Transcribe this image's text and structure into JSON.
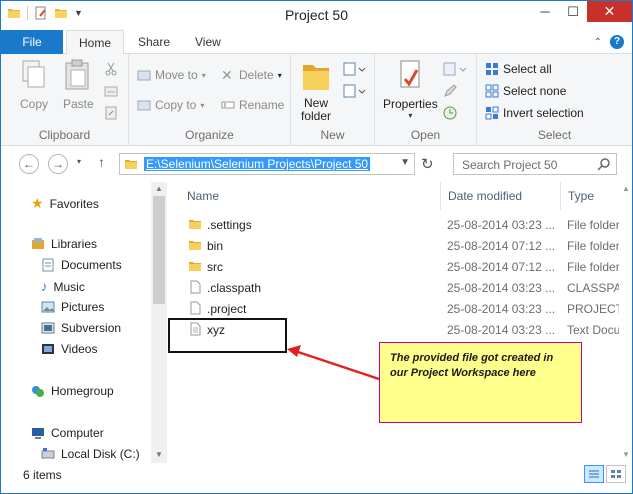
{
  "window": {
    "title": "Project 50"
  },
  "ribbon_tabs": [
    "File",
    "Home",
    "Share",
    "View"
  ],
  "ribbon": {
    "clipboard": {
      "copy": "Copy",
      "paste": "Paste",
      "group": "Clipboard"
    },
    "organize": {
      "move_to": "Move to",
      "copy_to": "Copy to",
      "delete": "Delete",
      "rename": "Rename",
      "group": "Organize"
    },
    "new": {
      "new_folder_l1": "New",
      "new_folder_l2": "folder",
      "group": "New"
    },
    "open": {
      "properties": "Properties",
      "group": "Open"
    },
    "select": {
      "select_all": "Select all",
      "select_none": "Select none",
      "invert": "Invert selection",
      "group": "Select"
    }
  },
  "address": {
    "path": "E:\\Selenium\\Selenium Projects\\Project 50"
  },
  "search": {
    "placeholder": "Search Project 50"
  },
  "nav": {
    "favorites": "Favorites",
    "libraries": "Libraries",
    "documents": "Documents",
    "music": "Music",
    "pictures": "Pictures",
    "subversion": "Subversion",
    "videos": "Videos",
    "homegroup": "Homegroup",
    "computer": "Computer",
    "local_disk": "Local Disk (C:)"
  },
  "columns": {
    "name": "Name",
    "date": "Date modified",
    "type": "Type"
  },
  "files": [
    {
      "name": ".settings",
      "date": "25-08-2014 03:23 ...",
      "type": "File folder",
      "icon": "folder-icon"
    },
    {
      "name": "bin",
      "date": "25-08-2014 07:12 ...",
      "type": "File folder",
      "icon": "folder-icon"
    },
    {
      "name": "src",
      "date": "25-08-2014 07:12 ...",
      "type": "File folder",
      "icon": "folder-icon"
    },
    {
      "name": ".classpath",
      "date": "25-08-2014 03:23 ...",
      "type": "CLASSPATH",
      "icon": "file-icon"
    },
    {
      "name": ".project",
      "date": "25-08-2014 03:23 ...",
      "type": "PROJECT Fi",
      "icon": "file-icon"
    },
    {
      "name": "xyz",
      "date": "25-08-2014 03:23 ...",
      "type": "Text Docum",
      "icon": "text-file-icon"
    }
  ],
  "annotation": {
    "text": "The provided file got created in our Project Workspace here"
  },
  "status": {
    "items": "6 items"
  },
  "colors": {
    "accent": "#1979ca",
    "close": "#c7312a",
    "selection": "#3399ff",
    "callout_bg": "#ffff8c",
    "arrow": "#e02020"
  }
}
